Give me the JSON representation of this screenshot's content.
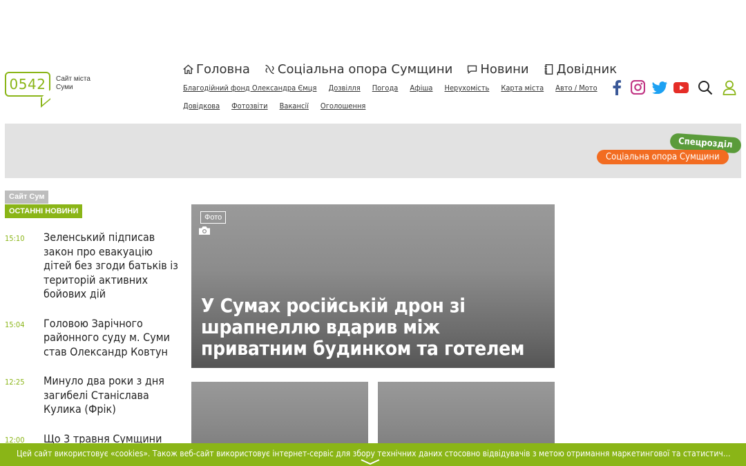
{
  "logo": {
    "number": "0542",
    "tagline": "Сайт міста Суми"
  },
  "main_nav": [
    {
      "label": "Головна",
      "icon": "home-icon"
    },
    {
      "label": "Соціальна опора Сумщини",
      "icon": "support-icon"
    },
    {
      "label": "Новини",
      "icon": "chat-icon"
    },
    {
      "label": "Довідник",
      "icon": "notebook-icon"
    }
  ],
  "sub_nav": [
    "Благодійний фонд Олександра Ємця",
    "Дозвілля",
    "Погода",
    "Афіша",
    "Нерухомість",
    "Карта міста",
    "Авто / Мото",
    "Довідкова",
    "Фотозвіти",
    "Вакансії",
    "Оголошення"
  ],
  "colors": {
    "accent": "#8ab517",
    "special": "#5a9b3a",
    "orange": "#f26c21",
    "facebook": "#3b5998",
    "instagram": "#c13584",
    "twitter": "#1da1f2",
    "youtube": "#e52d27"
  },
  "banner": {
    "special_tag": "Спецрозділ",
    "special_link": "Соціальна опора Сумщини"
  },
  "left": {
    "site_tag": "Сайт Сум",
    "latest_tag": "ОСТАННІ НОВИНИ",
    "news": [
      {
        "time": "15:10",
        "title": "Зеленський підписав закон про евакуацію дітей без згоди батьків із територій активних бойових дій"
      },
      {
        "time": "15:04",
        "title": "Головою Зарічного районного суду м. Суми став Олександр Ковтун"
      },
      {
        "time": "12:25",
        "title": "Минуло два роки з дня загибелі Станіслава Кулика (Фрік)"
      },
      {
        "time": "12:00",
        "title": "Що 3 травня Сумщини"
      }
    ]
  },
  "hero": {
    "badge": "Фото",
    "title": "У Сумах російській дрон зі шрапнеллю вдарив між приватним будинком та готелем"
  },
  "cookie": {
    "text": "Цей сайт використовує «cookies». Також веб-сайт використовує інтернет-сервіс для збору технічних даних стосовно відвідувачів з метою отримання маркетингової та статистичної інформації."
  }
}
